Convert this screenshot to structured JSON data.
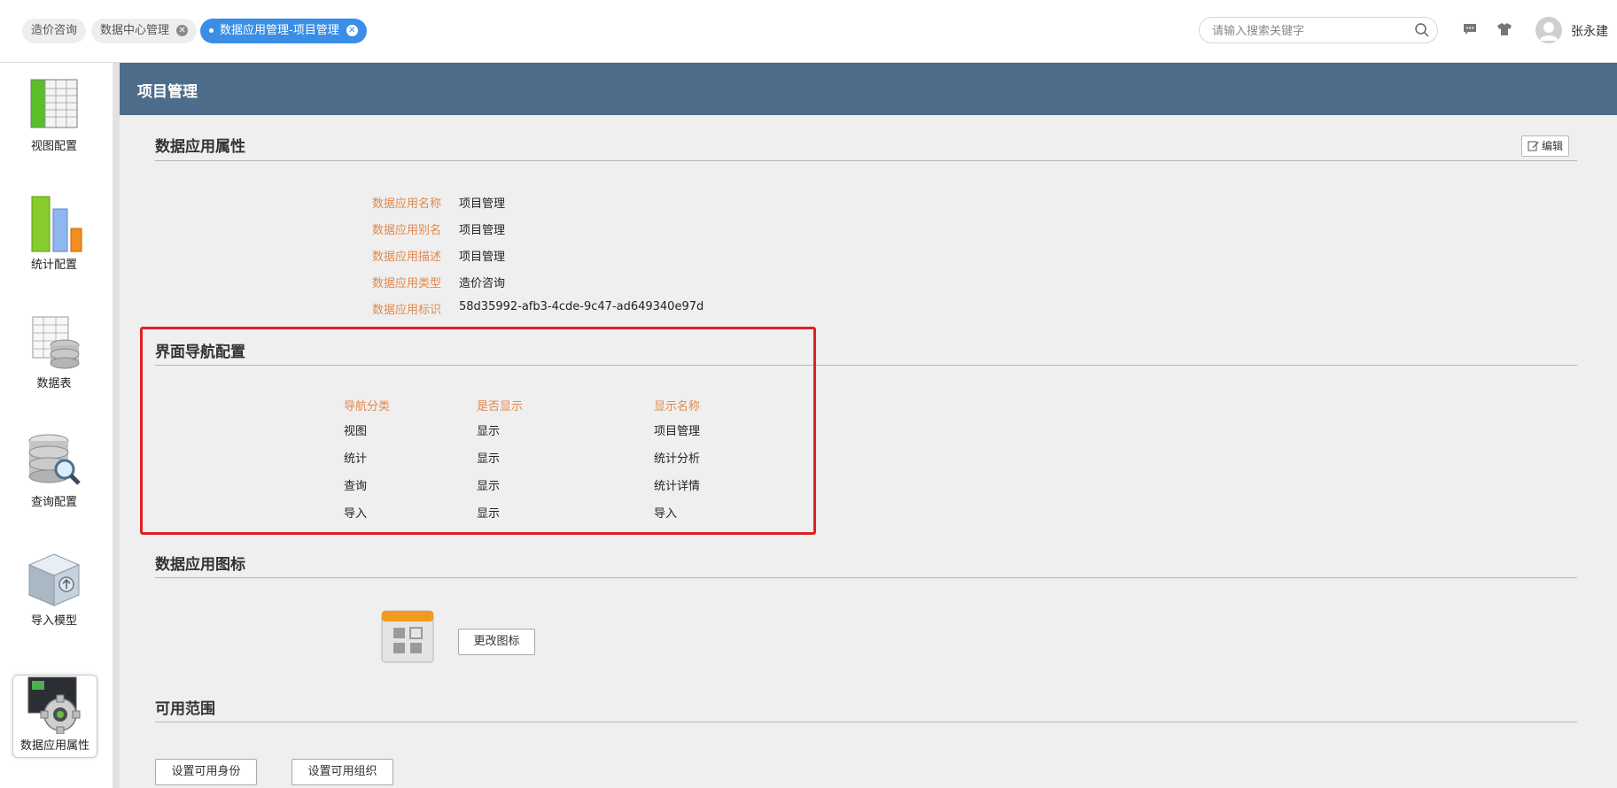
{
  "tabs": [
    {
      "label": "造价咨询"
    },
    {
      "label": "数据中心管理"
    },
    {
      "label": "数据应用管理-项目管理"
    }
  ],
  "search": {
    "placeholder": "请输入搜索关键字",
    "value": ""
  },
  "user": {
    "name": "张永建"
  },
  "sidebar": {
    "items": [
      {
        "label": "视图配置",
        "icon": "spreadsheet-icon"
      },
      {
        "label": "统计配置",
        "icon": "bar-chart-icon"
      },
      {
        "label": "数据表",
        "icon": "data-table-icon"
      },
      {
        "label": "查询配置",
        "icon": "database-search-icon"
      },
      {
        "label": "导入模型",
        "icon": "import-box-icon"
      },
      {
        "label": "数据应用属性",
        "icon": "settings-gear-icon"
      }
    ]
  },
  "header": {
    "title": "项目管理"
  },
  "properties": {
    "section_title": "数据应用属性",
    "edit_label": "编辑",
    "rows": [
      {
        "label": "数据应用名称",
        "value": "项目管理"
      },
      {
        "label": "数据应用别名",
        "value": "项目管理"
      },
      {
        "label": "数据应用描述",
        "value": "项目管理"
      },
      {
        "label": "数据应用类型",
        "value": "造价咨询"
      },
      {
        "label": "数据应用标识",
        "value": "58d35992-afb3-4cde-9c47-ad649340e97d"
      }
    ]
  },
  "nav_config": {
    "section_title": "界面导航配置",
    "columns": [
      "导航分类",
      "是否显示",
      "显示名称"
    ],
    "rows": [
      [
        "视图",
        "显示",
        "项目管理"
      ],
      [
        "统计",
        "显示",
        "统计分析"
      ],
      [
        "查询",
        "显示",
        "统计详情"
      ],
      [
        "导入",
        "显示",
        "导入"
      ]
    ]
  },
  "app_icon": {
    "section_title": "数据应用图标",
    "change_label": "更改图标"
  },
  "scope": {
    "section_title": "可用范围",
    "set_identity_label": "设置可用身份",
    "set_org_label": "设置可用组织"
  },
  "colors": {
    "header_bg": "#4d6d8a",
    "accent_orange": "#e0884d",
    "active_tab": "#3a8ee6",
    "highlight_red": "#e02020"
  }
}
